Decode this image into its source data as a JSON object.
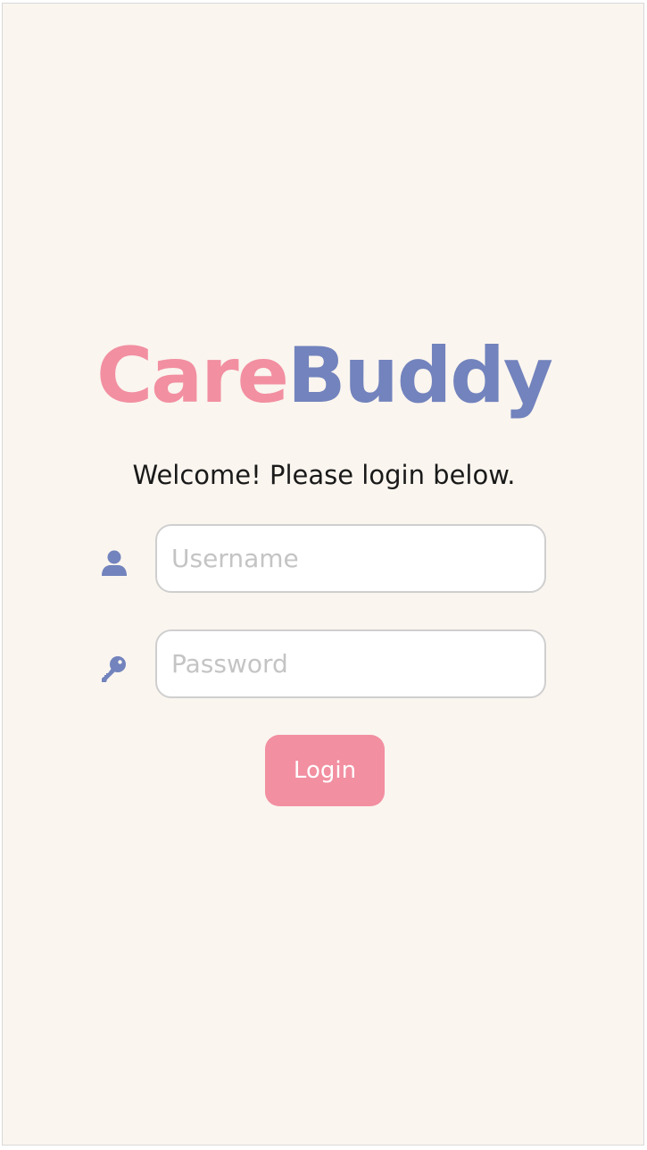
{
  "logo": {
    "part1": "Care",
    "part2": "Buddy",
    "colors": {
      "part1": "#f28fa1",
      "part2": "#7283bd"
    }
  },
  "welcome_text": "Welcome! Please login below.",
  "form": {
    "username": {
      "placeholder": "Username",
      "value": "",
      "icon": "user-icon"
    },
    "password": {
      "placeholder": "Password",
      "value": "",
      "icon": "key-icon"
    },
    "login_label": "Login"
  },
  "colors": {
    "background": "#faf5ef",
    "accent_pink": "#f28fa1",
    "accent_blue": "#7283bd"
  }
}
